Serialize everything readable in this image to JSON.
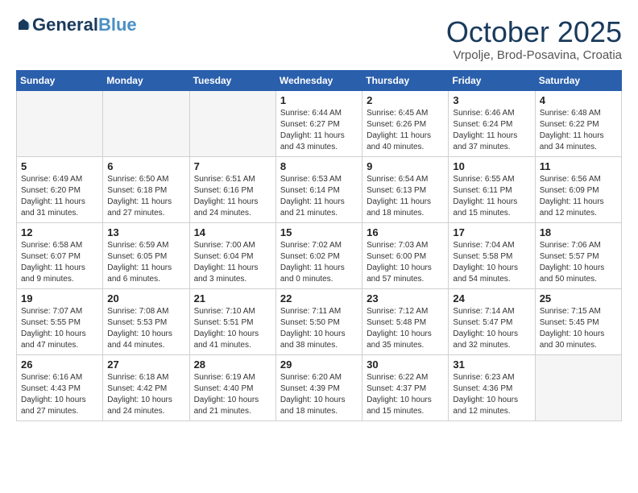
{
  "header": {
    "logo_general": "General",
    "logo_blue": "Blue",
    "month_title": "October 2025",
    "location": "Vrpolje, Brod-Posavina, Croatia"
  },
  "days_of_week": [
    "Sunday",
    "Monday",
    "Tuesday",
    "Wednesday",
    "Thursday",
    "Friday",
    "Saturday"
  ],
  "weeks": [
    [
      {
        "day": "",
        "info": ""
      },
      {
        "day": "",
        "info": ""
      },
      {
        "day": "",
        "info": ""
      },
      {
        "day": "1",
        "info": "Sunrise: 6:44 AM\nSunset: 6:27 PM\nDaylight: 11 hours\nand 43 minutes."
      },
      {
        "day": "2",
        "info": "Sunrise: 6:45 AM\nSunset: 6:26 PM\nDaylight: 11 hours\nand 40 minutes."
      },
      {
        "day": "3",
        "info": "Sunrise: 6:46 AM\nSunset: 6:24 PM\nDaylight: 11 hours\nand 37 minutes."
      },
      {
        "day": "4",
        "info": "Sunrise: 6:48 AM\nSunset: 6:22 PM\nDaylight: 11 hours\nand 34 minutes."
      }
    ],
    [
      {
        "day": "5",
        "info": "Sunrise: 6:49 AM\nSunset: 6:20 PM\nDaylight: 11 hours\nand 31 minutes."
      },
      {
        "day": "6",
        "info": "Sunrise: 6:50 AM\nSunset: 6:18 PM\nDaylight: 11 hours\nand 27 minutes."
      },
      {
        "day": "7",
        "info": "Sunrise: 6:51 AM\nSunset: 6:16 PM\nDaylight: 11 hours\nand 24 minutes."
      },
      {
        "day": "8",
        "info": "Sunrise: 6:53 AM\nSunset: 6:14 PM\nDaylight: 11 hours\nand 21 minutes."
      },
      {
        "day": "9",
        "info": "Sunrise: 6:54 AM\nSunset: 6:13 PM\nDaylight: 11 hours\nand 18 minutes."
      },
      {
        "day": "10",
        "info": "Sunrise: 6:55 AM\nSunset: 6:11 PM\nDaylight: 11 hours\nand 15 minutes."
      },
      {
        "day": "11",
        "info": "Sunrise: 6:56 AM\nSunset: 6:09 PM\nDaylight: 11 hours\nand 12 minutes."
      }
    ],
    [
      {
        "day": "12",
        "info": "Sunrise: 6:58 AM\nSunset: 6:07 PM\nDaylight: 11 hours\nand 9 minutes."
      },
      {
        "day": "13",
        "info": "Sunrise: 6:59 AM\nSunset: 6:05 PM\nDaylight: 11 hours\nand 6 minutes."
      },
      {
        "day": "14",
        "info": "Sunrise: 7:00 AM\nSunset: 6:04 PM\nDaylight: 11 hours\nand 3 minutes."
      },
      {
        "day": "15",
        "info": "Sunrise: 7:02 AM\nSunset: 6:02 PM\nDaylight: 11 hours\nand 0 minutes."
      },
      {
        "day": "16",
        "info": "Sunrise: 7:03 AM\nSunset: 6:00 PM\nDaylight: 10 hours\nand 57 minutes."
      },
      {
        "day": "17",
        "info": "Sunrise: 7:04 AM\nSunset: 5:58 PM\nDaylight: 10 hours\nand 54 minutes."
      },
      {
        "day": "18",
        "info": "Sunrise: 7:06 AM\nSunset: 5:57 PM\nDaylight: 10 hours\nand 50 minutes."
      }
    ],
    [
      {
        "day": "19",
        "info": "Sunrise: 7:07 AM\nSunset: 5:55 PM\nDaylight: 10 hours\nand 47 minutes."
      },
      {
        "day": "20",
        "info": "Sunrise: 7:08 AM\nSunset: 5:53 PM\nDaylight: 10 hours\nand 44 minutes."
      },
      {
        "day": "21",
        "info": "Sunrise: 7:10 AM\nSunset: 5:51 PM\nDaylight: 10 hours\nand 41 minutes."
      },
      {
        "day": "22",
        "info": "Sunrise: 7:11 AM\nSunset: 5:50 PM\nDaylight: 10 hours\nand 38 minutes."
      },
      {
        "day": "23",
        "info": "Sunrise: 7:12 AM\nSunset: 5:48 PM\nDaylight: 10 hours\nand 35 minutes."
      },
      {
        "day": "24",
        "info": "Sunrise: 7:14 AM\nSunset: 5:47 PM\nDaylight: 10 hours\nand 32 minutes."
      },
      {
        "day": "25",
        "info": "Sunrise: 7:15 AM\nSunset: 5:45 PM\nDaylight: 10 hours\nand 30 minutes."
      }
    ],
    [
      {
        "day": "26",
        "info": "Sunrise: 6:16 AM\nSunset: 4:43 PM\nDaylight: 10 hours\nand 27 minutes."
      },
      {
        "day": "27",
        "info": "Sunrise: 6:18 AM\nSunset: 4:42 PM\nDaylight: 10 hours\nand 24 minutes."
      },
      {
        "day": "28",
        "info": "Sunrise: 6:19 AM\nSunset: 4:40 PM\nDaylight: 10 hours\nand 21 minutes."
      },
      {
        "day": "29",
        "info": "Sunrise: 6:20 AM\nSunset: 4:39 PM\nDaylight: 10 hours\nand 18 minutes."
      },
      {
        "day": "30",
        "info": "Sunrise: 6:22 AM\nSunset: 4:37 PM\nDaylight: 10 hours\nand 15 minutes."
      },
      {
        "day": "31",
        "info": "Sunrise: 6:23 AM\nSunset: 4:36 PM\nDaylight: 10 hours\nand 12 minutes."
      },
      {
        "day": "",
        "info": ""
      }
    ]
  ]
}
